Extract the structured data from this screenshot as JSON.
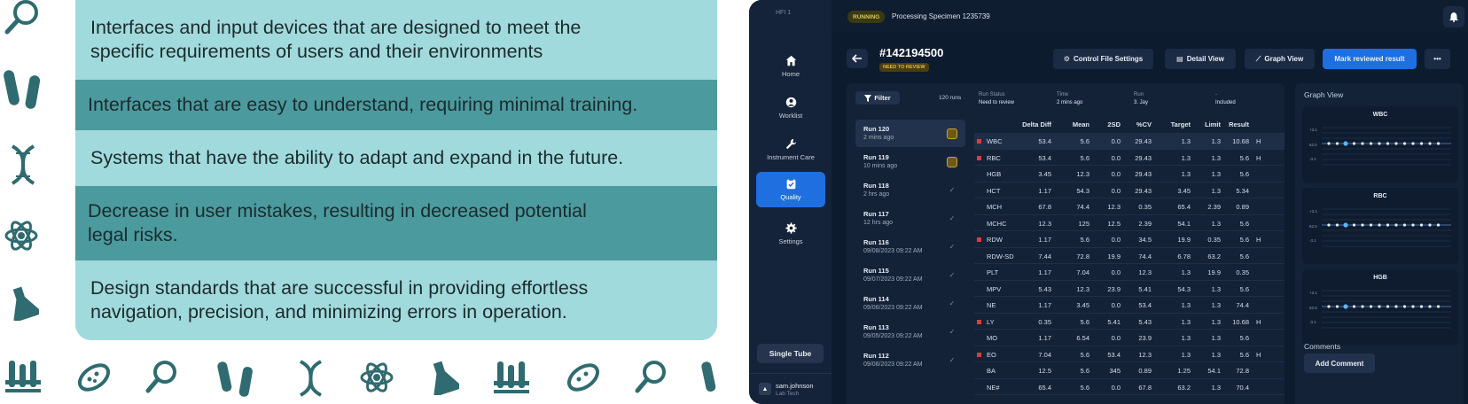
{
  "left": {
    "benefits": [
      {
        "line1": "Interfaces and input devices that are designed to meet the",
        "line2": "specific requirements of users and their environments"
      },
      {
        "line1": "Interfaces that are easy to understand, requiring minimal training.",
        "line2": ""
      },
      {
        "line1": "Systems that have the ability to adapt and expand in the future.",
        "line2": ""
      },
      {
        "line1": "Decrease in user mistakes, resulting in decreased potential",
        "line2": "legal risks."
      },
      {
        "line1": "Design standards that are successful in providing effortless",
        "line2": "navigation, precision, and minimizing errors in operation."
      }
    ],
    "decor_icons": [
      "magnifier-icon",
      "test-tubes-icon",
      "dna-icon",
      "atom-icon",
      "flask-icon",
      "tube-rack-icon",
      "bacteria-icon"
    ],
    "colors": {
      "card_light": "#a1dadc",
      "card_dark": "#4b9a9e",
      "icon": "#2f6b70"
    }
  },
  "app": {
    "brand": "HFI 1",
    "status_chip": "RUNNING",
    "processing": "Processing Specimen 1235739",
    "nav": [
      {
        "label": "Home",
        "icon": "home-icon"
      },
      {
        "label": "Worklist",
        "icon": "user-icon"
      },
      {
        "label": "Instrument Care",
        "icon": "wrench-icon"
      },
      {
        "label": "Quality",
        "icon": "clipboard-check-icon",
        "active": true
      },
      {
        "label": "Settings",
        "icon": "gear-icon"
      }
    ],
    "single_tube": "Single Tube",
    "user": {
      "name": "sam.johnson",
      "role": "Lab Tech"
    },
    "specimen_id": "#142194500",
    "review_badge": "NEED TO REVIEW",
    "buttons": {
      "control_file": "Control File Settings",
      "detail_view": "Detail View",
      "graph_view": "Graph View",
      "mark_reviewed": "Mark reviewed result",
      "more": "•••"
    },
    "filter_label": "Filter",
    "run_count": "120 runs",
    "meta": [
      {
        "label": "Run Status",
        "value": "Need to review"
      },
      {
        "label": "Time",
        "value": "2 mins ago"
      },
      {
        "label": "Run",
        "value": "3. Jay"
      },
      {
        "label": "-",
        "value": "Included"
      }
    ],
    "runs": [
      {
        "title": "Run 120",
        "sub": "2 mins ago",
        "state": "warn"
      },
      {
        "title": "Run 119",
        "sub": "10 mins ago",
        "state": "warn"
      },
      {
        "title": "Run 118",
        "sub": "2 hrs ago",
        "state": "ok"
      },
      {
        "title": "Run 117",
        "sub": "12 hrs ago",
        "state": "ok"
      },
      {
        "title": "Run 116",
        "sub": "09/08/2023 09:22 AM",
        "state": "ok"
      },
      {
        "title": "Run 115",
        "sub": "09/07/2023 09:22 AM",
        "state": "ok"
      },
      {
        "title": "Run 114",
        "sub": "09/06/2023 09:22 AM",
        "state": "ok"
      },
      {
        "title": "Run 113",
        "sub": "09/05/2023 09:22 AM",
        "state": "ok"
      },
      {
        "title": "Run 112",
        "sub": "09/06/2023 09:22 AM",
        "state": "ok"
      }
    ],
    "table_headers": [
      "Delta Diff",
      "Mean",
      "2SD",
      "%CV",
      "Target",
      "Limit",
      "Result"
    ],
    "table_rows": [
      {
        "name": "WBC",
        "vals": [
          "53.4",
          "5.6",
          "0.0",
          "29.43",
          "1.3",
          "1.3",
          "10.68"
        ],
        "flag": true,
        "h": "H"
      },
      {
        "name": "RBC",
        "vals": [
          "53.4",
          "5.6",
          "0.0",
          "29.43",
          "1.3",
          "1.3",
          "5.6"
        ],
        "flag": true,
        "h": "H"
      },
      {
        "name": "HGB",
        "vals": [
          "3.45",
          "12.3",
          "0.0",
          "29.43",
          "1.3",
          "1.3",
          "5.6"
        ],
        "flag": false,
        "h": ""
      },
      {
        "name": "HCT",
        "vals": [
          "1.17",
          "54.3",
          "0.0",
          "29.43",
          "3.45",
          "1.3",
          "5.34"
        ],
        "flag": false,
        "h": ""
      },
      {
        "name": "MCH",
        "vals": [
          "67.8",
          "74.4",
          "12.3",
          "0.35",
          "65.4",
          "2.39",
          "0.89"
        ],
        "flag": false,
        "h": ""
      },
      {
        "name": "MCHC",
        "vals": [
          "12.3",
          "125",
          "12.5",
          "2.39",
          "54.1",
          "1.3",
          "5.6"
        ],
        "flag": false,
        "h": ""
      },
      {
        "name": "RDW",
        "vals": [
          "1.17",
          "5.6",
          "0.0",
          "34.5",
          "19.9",
          "0.35",
          "5.6"
        ],
        "flag": true,
        "h": "H"
      },
      {
        "name": "RDW-SD",
        "vals": [
          "7.44",
          "72.8",
          "19.9",
          "74.4",
          "6.78",
          "63.2",
          "5.6"
        ],
        "flag": false,
        "h": ""
      },
      {
        "name": "PLT",
        "vals": [
          "1.17",
          "7.04",
          "0.0",
          "12.3",
          "1.3",
          "19.9",
          "0.35"
        ],
        "flag": false,
        "h": ""
      },
      {
        "name": "MPV",
        "vals": [
          "5.43",
          "12.3",
          "23.9",
          "5.41",
          "54.3",
          "1.3",
          "5.6"
        ],
        "flag": false,
        "h": ""
      },
      {
        "name": "NE",
        "vals": [
          "1.17",
          "3.45",
          "0.0",
          "53.4",
          "1.3",
          "1.3",
          "74.4"
        ],
        "flag": false,
        "h": ""
      },
      {
        "name": "LY",
        "vals": [
          "0.35",
          "5.6",
          "5.41",
          "5.43",
          "1.3",
          "1.3",
          "10.68"
        ],
        "flag": true,
        "h": "H"
      },
      {
        "name": "MO",
        "vals": [
          "1.17",
          "6.54",
          "0.0",
          "23.9",
          "1.3",
          "1.3",
          "5.6"
        ],
        "flag": false,
        "h": ""
      },
      {
        "name": "EO",
        "vals": [
          "7.04",
          "5.6",
          "53.4",
          "12.3",
          "1.3",
          "1.3",
          "5.6"
        ],
        "flag": true,
        "h": "H"
      },
      {
        "name": "BA",
        "vals": [
          "12.5",
          "5.6",
          "345",
          "0.89",
          "1.25",
          "54.1",
          "72.8"
        ],
        "flag": false,
        "h": ""
      },
      {
        "name": "NE#",
        "vals": [
          "65.4",
          "5.6",
          "0.0",
          "67.8",
          "63.2",
          "1.3",
          "70.4"
        ],
        "flag": false,
        "h": ""
      }
    ],
    "graph_view_title": "Graph View",
    "graphs": [
      {
        "title": "WBC",
        "labels": [
          "+3.1",
          "62.5",
          "-3.1"
        ]
      },
      {
        "title": "RBC",
        "labels": [
          "+3.1",
          "62.5",
          "-3.1"
        ]
      },
      {
        "title": "HGB",
        "labels": [
          "+3.1",
          "62.5",
          "-3.1"
        ]
      }
    ],
    "comments_label": "Comments",
    "add_comment": "Add Comment",
    "colors": {
      "bg": "#0d1b2e",
      "panel": "#142238",
      "accent": "#1f6fe0",
      "flag_red": "#e03a3a",
      "warn": "#c8a735"
    }
  }
}
